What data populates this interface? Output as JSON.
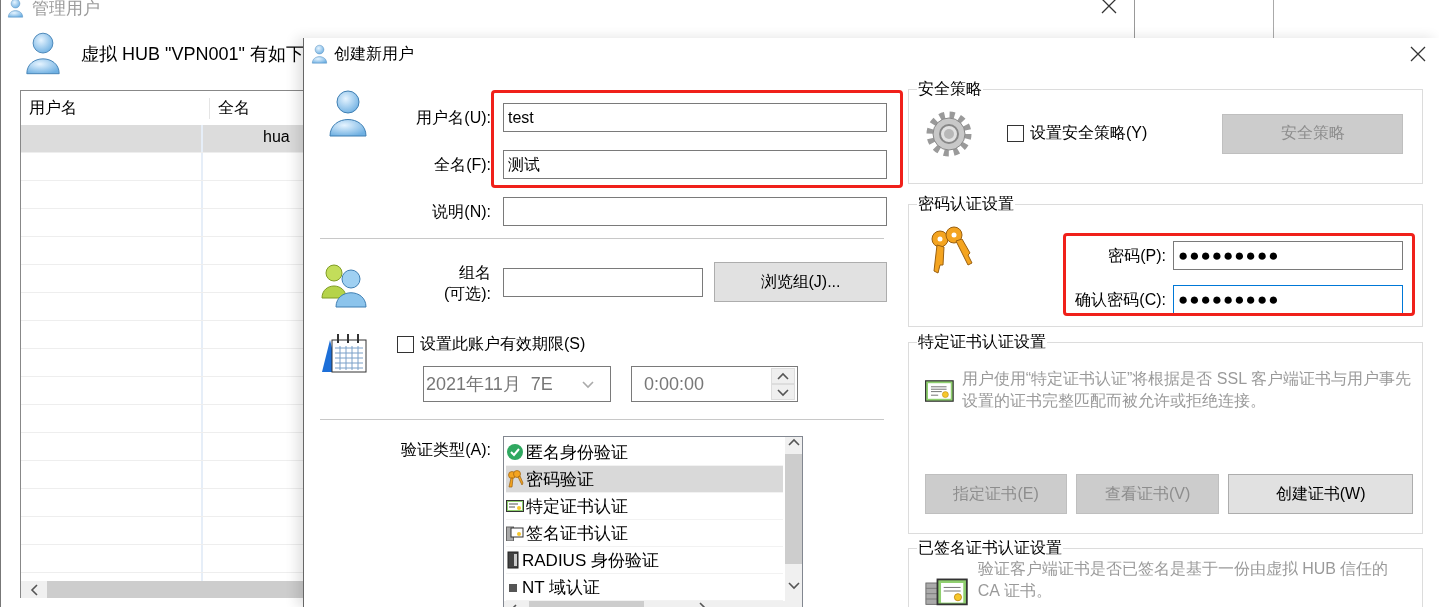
{
  "background_window": {
    "title": "管理用户",
    "header_text": "虚拟 HUB \"VPN001\" 有如下",
    "table": {
      "columns": [
        "用户名",
        "全名"
      ],
      "rows": [
        {
          "column_2": "hua",
          "selected": true
        }
      ]
    }
  },
  "dialog": {
    "title": "创建新用户",
    "user_fields": [
      {
        "label": "用户名(U):",
        "value": "test"
      },
      {
        "label": "全名(F):",
        "value": "测试"
      },
      {
        "label": "说明(N):"
      }
    ],
    "group": {
      "label_lines": [
        "组名",
        "(可选):"
      ],
      "browse_button": "浏览组(J)..."
    },
    "expiry": {
      "label": "设置此账户有效期限(S)",
      "checked": false,
      "disabled": true,
      "date": "2021年11月  7E",
      "time": "0:00:00"
    },
    "auth_type": {
      "label": "验证类型(A):",
      "items": [
        {
          "label": "匿名身份验证",
          "kind": "anonymous",
          "selected": false
        },
        {
          "label": "密码验证",
          "kind": "password",
          "selected": true
        },
        {
          "label": "特定证书认证",
          "kind": "certificate",
          "selected": false
        },
        {
          "label": "签名证书认证",
          "kind": "signed",
          "selected": false
        },
        {
          "label": "RADIUS 身份验证",
          "kind": "radius",
          "selected": false
        },
        {
          "label": "NT 域认证",
          "kind": "nt",
          "selected": false
        }
      ]
    },
    "security_policy": {
      "title": "安全策略",
      "checkbox": {
        "label": "设置安全策略(Y)",
        "checked": false
      },
      "button": {
        "label": "安全策略",
        "disabled": true
      }
    },
    "password_auth": {
      "title": "密码认证设置",
      "fields": [
        {
          "label": "密码(P):",
          "value": "●●●●●●●●●",
          "focused": false
        },
        {
          "label": "确认密码(C):",
          "value": "●●●●●●●●●",
          "focused": true
        }
      ]
    },
    "cert_auth": {
      "title": "特定证书认证设置",
      "description": "用户使用“特定证书认证”将根据是否 SSL 客户端证书与用户事先设置的证书完整匹配而被允许或拒绝连接。",
      "buttons": [
        {
          "label": "指定证书(E)",
          "disabled": true
        },
        {
          "label": "查看证书(V)",
          "disabled": true
        },
        {
          "label": "创建证书(W)",
          "disabled": false
        }
      ]
    },
    "signed_cert_auth": {
      "title": "已签名证书认证设置",
      "description": "验证客户端证书是否已签名是基于一份由虚拟 HUB 信任的 CA 证书。"
    }
  }
}
